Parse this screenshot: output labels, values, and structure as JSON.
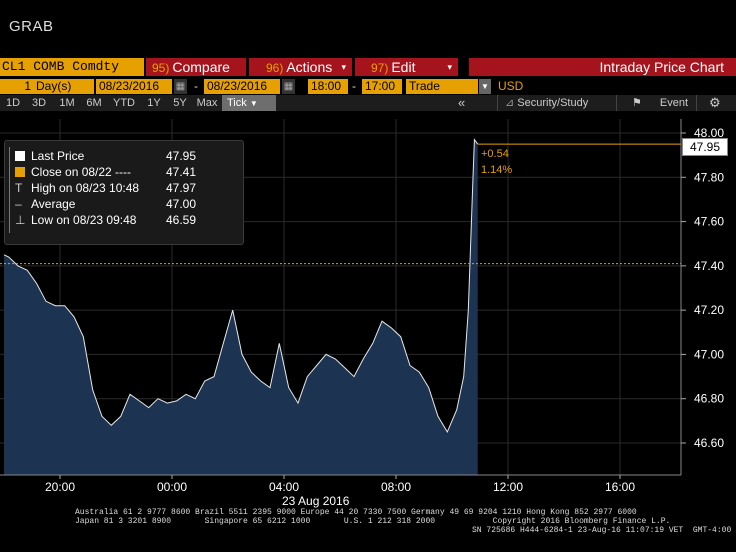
{
  "window": {
    "label": "GRAB"
  },
  "toolbar": {
    "ticker": "CL1 COMB Comdty",
    "compare": {
      "num": "95)",
      "label": "Compare"
    },
    "actions": {
      "num": "96)",
      "label": "Actions"
    },
    "edit": {
      "num": "97)",
      "label": "Edit"
    },
    "title": "Intraday Price Chart"
  },
  "params": {
    "days_count": "1",
    "days_unit": "Day(s)",
    "date_from": "08/23/2016",
    "date_to": "08/23/2016",
    "time_from": "18:00",
    "time_to": "17:00",
    "event_type": "Trade",
    "currency": "USD",
    "dash": "-"
  },
  "ranges": [
    "1D",
    "3D",
    "1M",
    "6M",
    "YTD",
    "1Y",
    "5Y",
    "Max"
  ],
  "range_selected": "Tick",
  "tools": {
    "collapse": "《",
    "security_study": "Security/Study",
    "event": "Event"
  },
  "legend": {
    "last_price": {
      "label": "Last Price",
      "value": "47.95"
    },
    "close": {
      "label": "Close on 08/22 ----",
      "value": "47.41"
    },
    "high": {
      "label": "High on 08/23 10:48",
      "value": "47.97"
    },
    "average": {
      "label": "Average",
      "value": "47.00"
    },
    "low": {
      "label": "Low on 08/23 09:48",
      "value": "46.59"
    }
  },
  "chart_data": {
    "type": "area",
    "x_ticks": [
      "20:00",
      "00:00",
      "04:00",
      "08:00",
      "12:00",
      "16:00"
    ],
    "y_ticks": [
      "48.00",
      "47.80",
      "47.60",
      "47.40",
      "47.20",
      "47.00",
      "46.80",
      "46.60"
    ],
    "ylim": [
      46.5,
      48.05
    ],
    "x_date_label": "23 Aug 2016",
    "last_price": "47.95",
    "change_abs": "+0.54",
    "change_pct": "1.14%",
    "previous_close": 47.41,
    "x": [
      "18:00",
      "18:10",
      "18:30",
      "18:50",
      "19:10",
      "19:30",
      "19:50",
      "20:10",
      "20:30",
      "20:50",
      "21:10",
      "21:30",
      "21:50",
      "22:10",
      "22:30",
      "22:50",
      "23:10",
      "23:30",
      "23:50",
      "00:10",
      "00:30",
      "00:50",
      "01:10",
      "01:30",
      "01:50",
      "02:10",
      "02:30",
      "02:50",
      "03:10",
      "03:30",
      "03:50",
      "04:10",
      "04:30",
      "04:50",
      "05:10",
      "05:30",
      "05:50",
      "06:10",
      "06:30",
      "06:50",
      "07:10",
      "07:30",
      "07:50",
      "08:10",
      "08:30",
      "08:50",
      "09:10",
      "09:30",
      "09:50",
      "10:10",
      "10:25",
      "10:35",
      "10:45",
      "10:48",
      "10:55"
    ],
    "values": [
      47.45,
      47.44,
      47.4,
      47.38,
      47.32,
      47.24,
      47.22,
      47.22,
      47.17,
      47.08,
      46.84,
      46.72,
      46.68,
      46.72,
      46.82,
      46.79,
      46.76,
      46.8,
      46.78,
      46.79,
      46.82,
      46.8,
      46.88,
      46.9,
      47.05,
      47.2,
      47.0,
      46.92,
      46.88,
      46.85,
      47.05,
      46.85,
      46.78,
      46.9,
      46.95,
      47.0,
      46.98,
      46.94,
      46.9,
      46.98,
      47.05,
      47.15,
      47.12,
      47.08,
      46.95,
      46.92,
      46.85,
      46.72,
      46.65,
      46.75,
      46.9,
      47.2,
      47.8,
      47.97,
      47.95
    ]
  },
  "footer": {
    "line1": "Australia 61 2 9777 8600 Brazil 5511 2395 9000 Europe 44 20 7330 7500 Germany 49 69 9204 1210 Hong Kong 852 2977 6000",
    "line2": "Japan 81 3 3201 8900       Singapore 65 6212 1000       U.S. 1 212 318 2000            Copyright 2016 Bloomberg Finance L.P.",
    "line3": "SN 725686 H444-6284-1 23-Aug-16 11:07:19 VET  GMT-4:00"
  },
  "colors": {
    "accent": "#e6a000",
    "red": "#a5141d",
    "area": "#1c3452",
    "prev_close": "#e6a000"
  }
}
